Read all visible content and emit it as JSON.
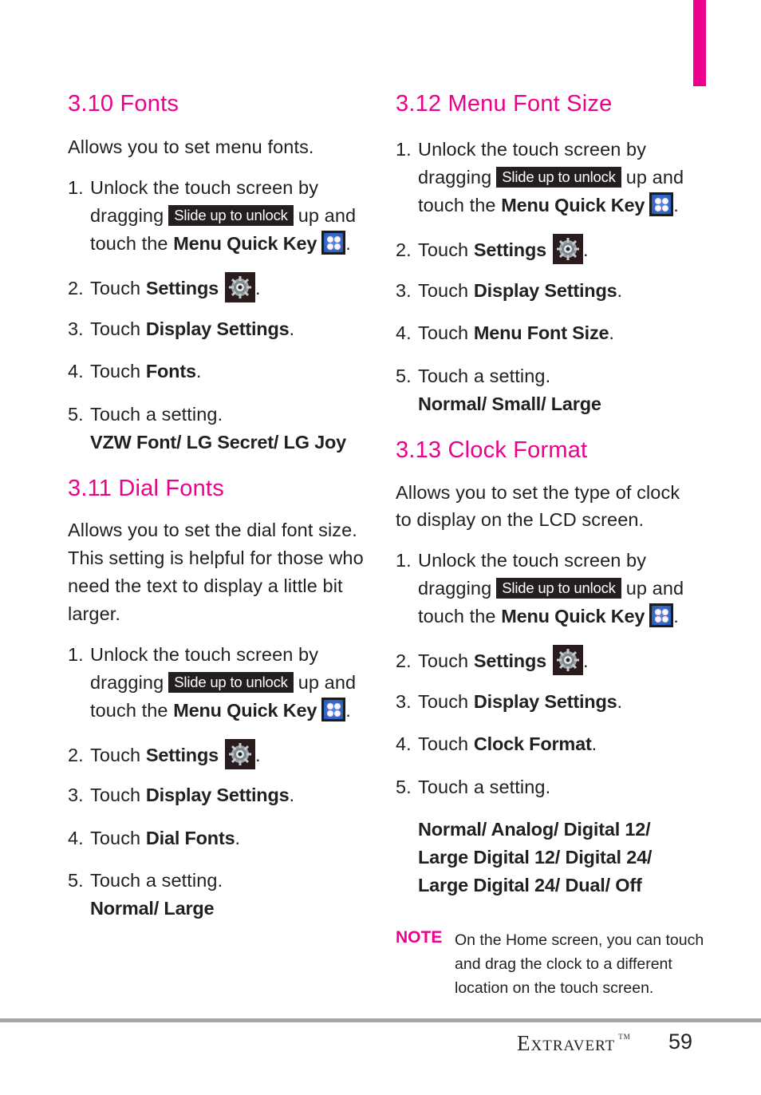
{
  "accent_color": "#ec008c",
  "common": {
    "unlock_line1": "Unlock the touch screen by",
    "dragging": "dragging",
    "slide_label": "Slide up to unlock",
    "up_and": "up and",
    "touch_the": "touch the",
    "menu_quick_key": "Menu Quick Key",
    "touch": "Touch",
    "settings": "Settings",
    "display_settings": "Display Settings",
    "touch_a_setting": "Touch a setting.",
    "period": ".",
    "icons": {
      "menu_key": "menu-quick-key-icon",
      "settings": "settings-gear-icon"
    }
  },
  "sections": [
    {
      "title": "3.10 Fonts",
      "intro": "Allows you to set menu fonts.",
      "step4_target": "Fonts",
      "options": "VZW Font/ LG Secret/ LG Joy"
    },
    {
      "title": "3.11  Dial Fonts",
      "intro_lines": [
        "Allows you to set the dial font size.",
        "This setting is helpful for those who",
        "need the text to display a little bit",
        "larger."
      ],
      "step4_target": "Dial Fonts",
      "options": "Normal/ Large"
    },
    {
      "title": "3.12 Menu Font Size",
      "step4_target": "Menu Font Size",
      "options": "Normal/ Small/ Large"
    },
    {
      "title": "3.13 Clock Format",
      "intro_lines": [
        "Allows you to set the type of clock",
        "to display on the LCD screen."
      ],
      "step4_target": "Clock Format",
      "options_lines": [
        "Normal/ Analog/ Digital 12/",
        "Large Digital 12/ Digital 24/",
        "Large Digital 24/ Dual/ Off"
      ]
    }
  ],
  "steps": {
    "s1": "1.",
    "s2": "2.",
    "s3": "3.",
    "s4": "4.",
    "s5": "5."
  },
  "note": {
    "label": "NOTE",
    "lines": [
      "On the Home screen, you can touch",
      "and drag the clock to a different",
      "location on the touch screen."
    ]
  },
  "footer": {
    "brand": "Extravert",
    "trademark": "TM",
    "page_number": "59"
  }
}
